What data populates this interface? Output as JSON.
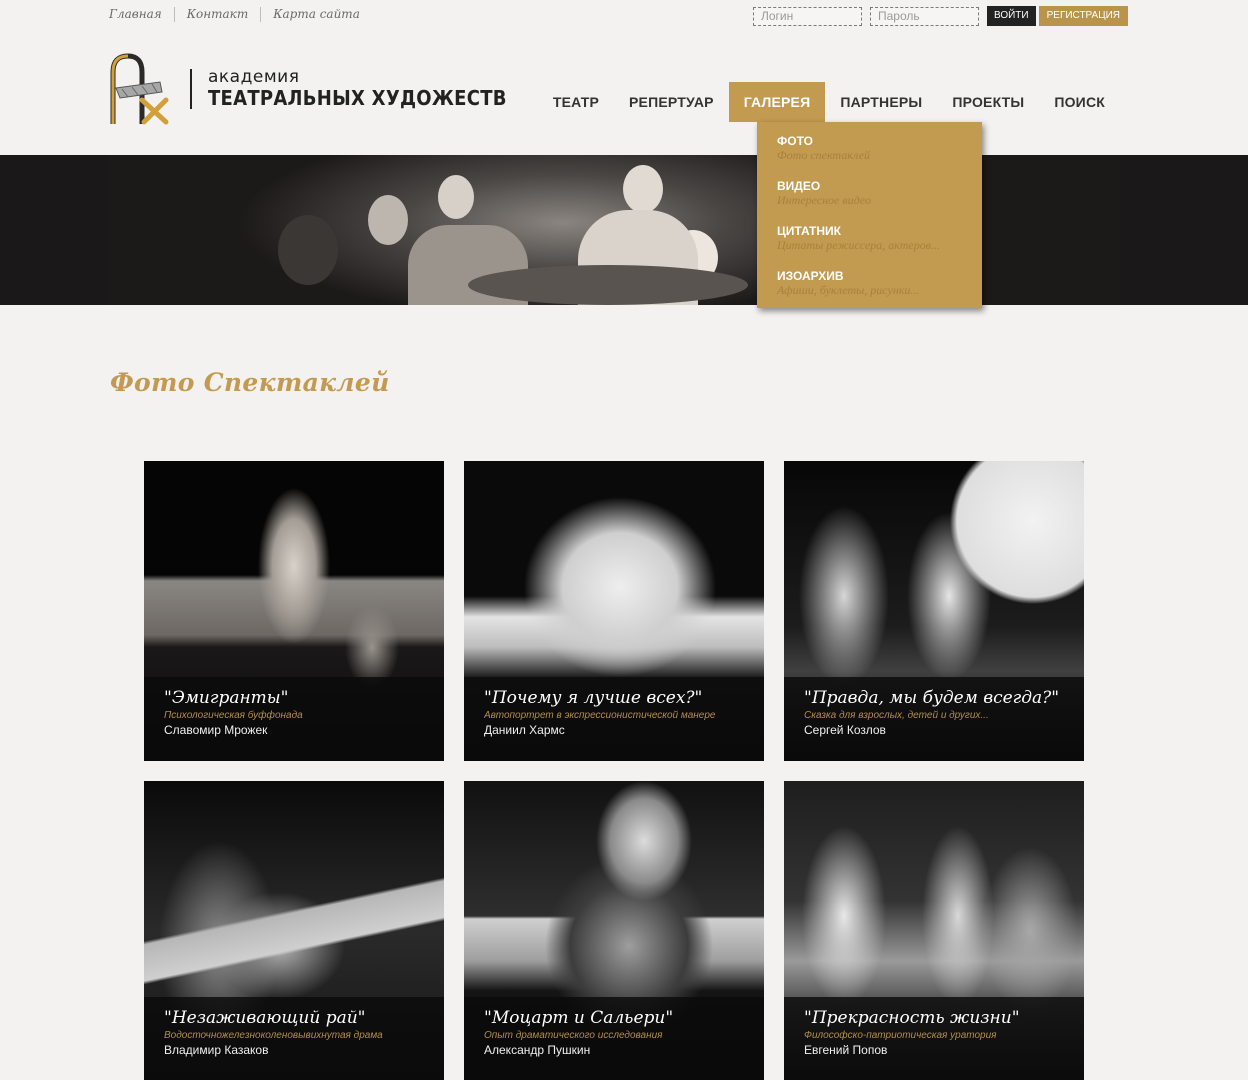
{
  "toplinks": [
    "Главная",
    "Контакт",
    "Карта сайта"
  ],
  "login": {
    "login_placeholder": "Логин",
    "password_placeholder": "Пароль",
    "submit_label": "ВОЙТИ",
    "register_label": "РЕГИСТРАЦИЯ"
  },
  "logo": {
    "small": "академия",
    "big": "ТЕАТРАЛЬНЫХ ХУДОЖЕСТВ"
  },
  "nav": [
    "ТЕАТР",
    "РЕПЕРТУАР",
    "ГАЛЕРЕЯ",
    "ПАРТНЕРЫ",
    "ПРОЕКТЫ",
    "ПОИСК"
  ],
  "nav_active": "ГАЛЕРЕЯ",
  "dropdown": [
    {
      "title": "ФОТО",
      "sub": "Фото спектаклей"
    },
    {
      "title": "ВИДЕО",
      "sub": "Интересное видео"
    },
    {
      "title": "ЦИТАТНИК",
      "sub": "Цитаты режиссера, актеров..."
    },
    {
      "title": "ИЗОАРХИВ",
      "sub": "Афиши, буклеты, рисунки..."
    }
  ],
  "page_title": "Фото Спектаклей",
  "cards": [
    {
      "title": "\"Эмигранты\"",
      "subtitle": "Психологическая буффонада",
      "author": "Славомир Мрожек"
    },
    {
      "title": "\"Почему я лучше всех?\"",
      "subtitle": "Автопортрет в экспрессионистической манере",
      "author": "Даниил Хармс"
    },
    {
      "title": "\"Правда, мы будем всегда?\"",
      "subtitle": "Сказка для взрослых, детей и других...",
      "author": "Сергей Козлов"
    },
    {
      "title": "\"Незаживающий рай\"",
      "subtitle": "Водосточножелезноколеновывихнутая драма",
      "author": "Владимир Казаков"
    },
    {
      "title": "\"Моцарт и Сальери\"",
      "subtitle": "Опыт драматического исследования",
      "author": "Александр Пушкин"
    },
    {
      "title": "\"Прекрасность жизни\"",
      "subtitle": "Философско-патриотическая уратория",
      "author": "Евгений Попов"
    }
  ],
  "colors": {
    "accent": "#c29a50",
    "background": "#f3f2f0",
    "dark": "#0d0d0d"
  }
}
